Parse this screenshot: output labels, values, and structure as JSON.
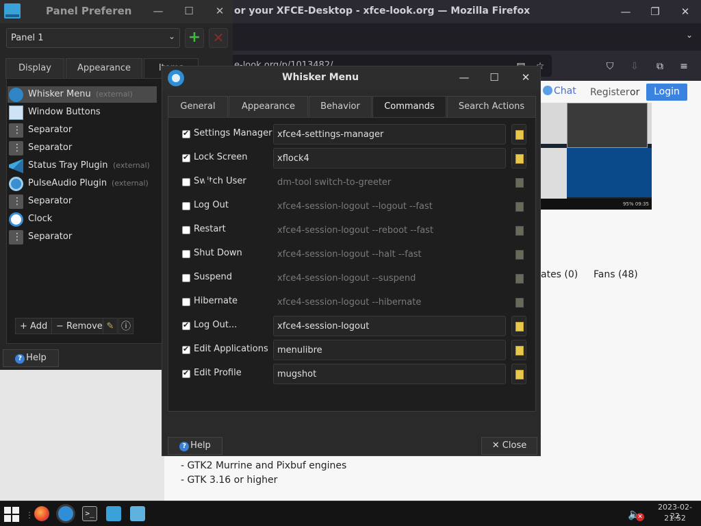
{
  "firefox": {
    "title": "or your XFCE-Desktop - xfce-look.org — Mozilla Firefox",
    "url": "e-look.org/p/1013482/",
    "chat": "Chat",
    "register": "Register",
    "or": "or",
    "login": "Login",
    "rates": "ates (0)",
    "fans": "Fans (48)",
    "lines": [
      "- GTK2 Murrine and Pixbuf engines",
      "- GTK 3.16 or higher"
    ],
    "screenshot_clock": "95% 09:35"
  },
  "panel_prefs": {
    "title": "Panel Preferen",
    "panel_select": "Panel 1",
    "tabs": [
      "Display",
      "Appearance",
      "Items"
    ],
    "items": [
      {
        "label": "Whisker Menu",
        "ext": "(external)",
        "icon": "whisker-icon",
        "selected": true
      },
      {
        "label": "Window Buttons",
        "ext": "",
        "icon": "window-buttons-icon"
      },
      {
        "label": "Separator",
        "ext": "",
        "icon": "separator-icon"
      },
      {
        "label": "Separator",
        "ext": "",
        "icon": "separator-icon"
      },
      {
        "label": "Status Tray Plugin",
        "ext": "(external)",
        "icon": "status-tray-icon"
      },
      {
        "label": "PulseAudio Plugin",
        "ext": "(external)",
        "icon": "pulseaudio-icon"
      },
      {
        "label": "Separator",
        "ext": "",
        "icon": "separator-icon"
      },
      {
        "label": "Clock",
        "ext": "",
        "icon": "clock-icon"
      },
      {
        "label": "Separator",
        "ext": "",
        "icon": "separator-icon"
      }
    ],
    "add_label": "+ Add",
    "remove_label": "− Remove",
    "help_label": "Help"
  },
  "whisker": {
    "title": "Whisker Menu",
    "tabs": [
      "General",
      "Appearance",
      "Behavior",
      "Commands",
      "Search Actions"
    ],
    "active_tab": "Commands",
    "commands": [
      {
        "label": "Settings Manager",
        "checked": true,
        "value": "xfce4-settings-manager"
      },
      {
        "label": "Lock Screen",
        "checked": true,
        "value": "xflock4"
      },
      {
        "label": "Switch User",
        "checked": false,
        "value": "dm-tool switch-to-greeter"
      },
      {
        "label": "Log Out",
        "checked": false,
        "value": "xfce4-session-logout --logout --fast"
      },
      {
        "label": "Restart",
        "checked": false,
        "value": "xfce4-session-logout --reboot --fast"
      },
      {
        "label": "Shut Down",
        "checked": false,
        "value": "xfce4-session-logout --halt --fast"
      },
      {
        "label": "Suspend",
        "checked": false,
        "value": "xfce4-session-logout --suspend"
      },
      {
        "label": "Hibernate",
        "checked": false,
        "value": "xfce4-session-logout --hibernate"
      },
      {
        "label": "Log Out...",
        "checked": true,
        "value": "xfce4-session-logout"
      },
      {
        "label": "Edit Applications",
        "checked": true,
        "value": "menulibre"
      },
      {
        "label": "Edit Profile",
        "checked": true,
        "value": "mugshot"
      }
    ],
    "help_label": "Help",
    "close_label": "Close"
  },
  "taskbar": {
    "date": "2023-02-22",
    "time": "21:52",
    "terminal_glyph": ">_"
  },
  "colors": {
    "accent_blue": "#3a83e0",
    "add_green": "#3cbc3c",
    "remove_red": "#8a2a2a",
    "mute_red": "#d12a2a"
  }
}
